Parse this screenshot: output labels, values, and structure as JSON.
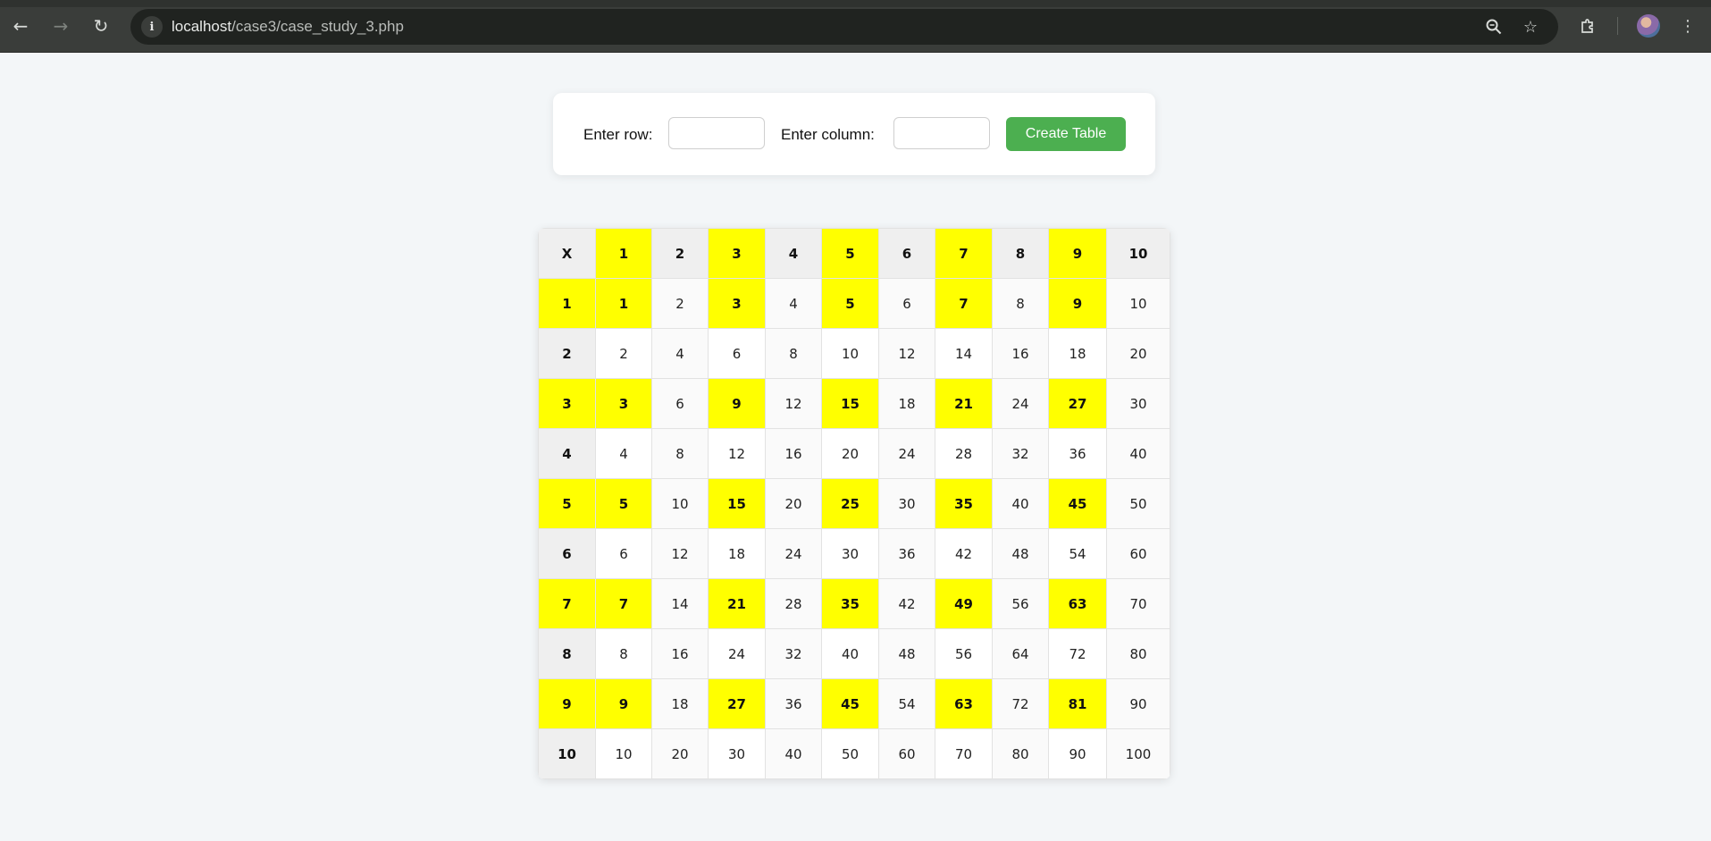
{
  "browser": {
    "url_host": "localhost",
    "url_path": "/case3/case_study_3.php",
    "icons": {
      "back": "arrow-left-icon",
      "forward": "arrow-right-icon",
      "reload": "reload-icon",
      "site_info": "info-icon",
      "zoom": "zoom-out-icon",
      "bookmark": "star-icon",
      "extensions": "puzzle-icon",
      "menu": "kebab-menu-icon"
    }
  },
  "form": {
    "row_label": "Enter row:",
    "row_value": "",
    "column_label": "Enter column:",
    "column_value": "",
    "button_label": "Create Table",
    "button_color": "#4caf50"
  },
  "table": {
    "corner": "X",
    "column_headers": [
      1,
      2,
      3,
      4,
      5,
      6,
      7,
      8,
      9,
      10
    ],
    "row_headers": [
      1,
      2,
      3,
      4,
      5,
      6,
      7,
      8,
      9,
      10
    ],
    "highlight_rule": "row header odd and column header odd",
    "highlight_color": "#ffff00",
    "rows": [
      [
        1,
        2,
        3,
        4,
        5,
        6,
        7,
        8,
        9,
        10
      ],
      [
        2,
        4,
        6,
        8,
        10,
        12,
        14,
        16,
        18,
        20
      ],
      [
        3,
        6,
        9,
        12,
        15,
        18,
        21,
        24,
        27,
        30
      ],
      [
        4,
        8,
        12,
        16,
        20,
        24,
        28,
        32,
        36,
        40
      ],
      [
        5,
        10,
        15,
        20,
        25,
        30,
        35,
        40,
        45,
        50
      ],
      [
        6,
        12,
        18,
        24,
        30,
        36,
        42,
        48,
        54,
        60
      ],
      [
        7,
        14,
        21,
        28,
        35,
        42,
        49,
        56,
        63,
        70
      ],
      [
        8,
        16,
        24,
        32,
        40,
        48,
        56,
        64,
        72,
        80
      ],
      [
        9,
        18,
        27,
        36,
        45,
        54,
        63,
        72,
        81,
        90
      ],
      [
        10,
        20,
        30,
        40,
        50,
        60,
        70,
        80,
        90,
        100
      ]
    ]
  }
}
